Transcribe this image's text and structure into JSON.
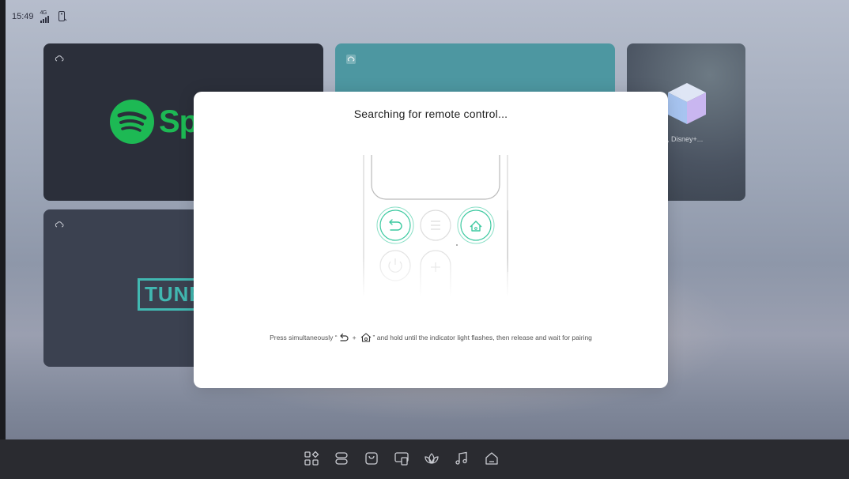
{
  "status_bar": {
    "time": "15:49",
    "signal_label": "4G"
  },
  "tiles": {
    "spotify": {
      "brand_text": "Sp",
      "brand_color": "#1db954"
    },
    "tunein": {
      "brand_text": "TUNE",
      "brand_color": "#41b8b1"
    },
    "streaming": {
      "caption": "ube, Disney+..."
    }
  },
  "dialog": {
    "title": "Searching for remote control...",
    "instruction_prefix": "Press simultaneously “",
    "instruction_plus": "+",
    "instruction_suffix": "” and hold until the indicator light flashes, then release and wait for pairing",
    "accent_color": "#3cc9a0"
  },
  "dock": {
    "icons": [
      "apps-icon",
      "layout-icon",
      "store-icon",
      "cast-screen-icon",
      "wellness-icon",
      "music-icon",
      "home-icon"
    ]
  }
}
